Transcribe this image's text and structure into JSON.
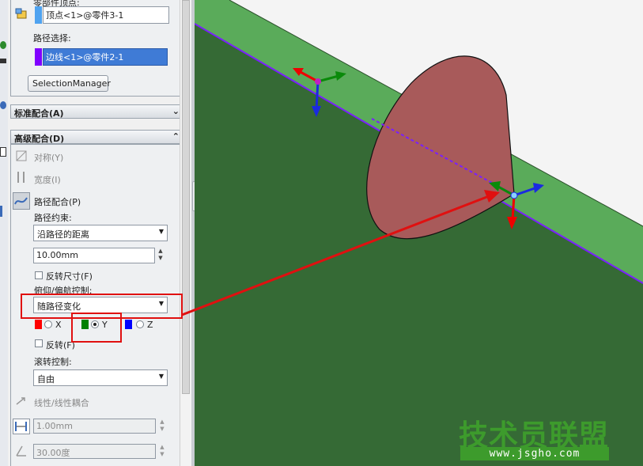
{
  "top_section": {
    "vertex_label_cut": "零部件顶点:",
    "vertex_value": "顶点<1>@零件3-1",
    "path_label": "路径选择:",
    "path_value": "边线<1>@零件2-1",
    "selection_manager": "SelectionManager"
  },
  "standard_mates": {
    "title": "标准配合(A)"
  },
  "advanced_mates": {
    "title": "高级配合(D)",
    "symmetric": "对称(Y)",
    "width": "宽度(I)",
    "path_mate": "路径配合(P)",
    "path_constraint_label": "路径约束:",
    "path_constraint_value": "沿路径的距离",
    "distance_value": "10.00mm",
    "flip_dimension": "反转尺寸(F)",
    "pitch_yaw_label": "俯仰/偏航控制:",
    "pitch_yaw_value": "随路径变化",
    "axis_x": "X",
    "axis_y": "Y",
    "axis_z": "Z",
    "selected_axis": "Y",
    "flip": "反转(F)",
    "roll_label": "滚转控制:",
    "roll_value": "自由",
    "linear_coupler": "线性/线性耦合",
    "distance_disabled": "1.00mm",
    "angle_disabled": "30.00度"
  },
  "colors": {
    "x_axis": "#ff0000",
    "y_axis": "#008000",
    "z_axis": "#0000ff",
    "path_swatch": "#8000ff",
    "vertex_swatch": "#4fa3f0",
    "annotation": "#e01010",
    "model_top": "#5aab5a",
    "model_face": "#356a35",
    "cone": "#a85a5a",
    "edge": "#7a1fff"
  },
  "watermark": {
    "title": "技术员联盟",
    "url": "www.jsgho.com"
  }
}
